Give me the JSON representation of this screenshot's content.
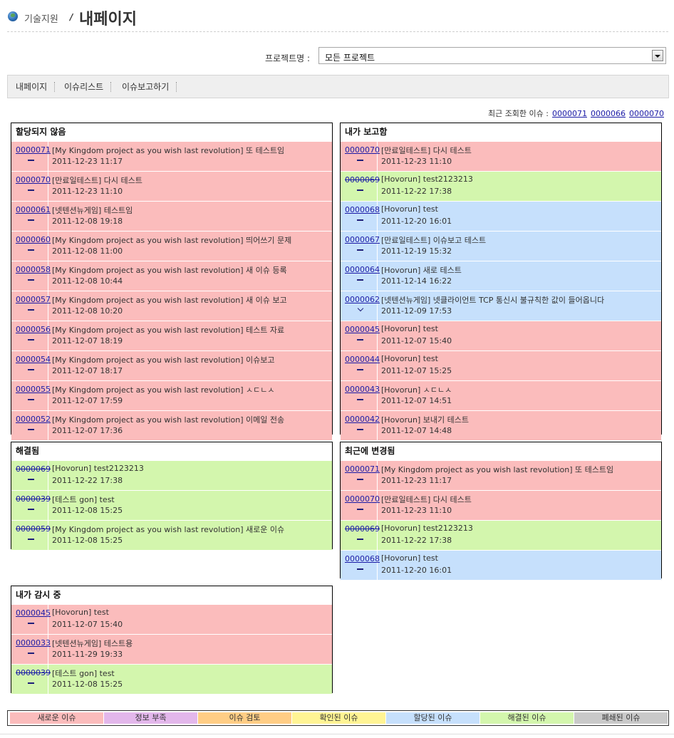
{
  "header": {
    "home": "기술지원",
    "separator": "/",
    "title": "내페이지"
  },
  "project_filter": {
    "label": "프로젝트명 :",
    "selected": "모든 프로젝트"
  },
  "tabs": [
    "내페이지",
    "이슈리스트",
    "이슈보고하기"
  ],
  "recent": {
    "label": "최근 조회한 이슈 :",
    "ids": [
      "0000071",
      "0000066",
      "0000070"
    ]
  },
  "panels": {
    "unassigned": {
      "title": "할당되지 않음",
      "rows": [
        {
          "id": "0000071",
          "title": "[My Kingdom project as you wish last revolution] 또 테스트임",
          "date": "2011-12-23 11:17",
          "status": "new"
        },
        {
          "id": "0000070",
          "title": "[만료일테스트] 다시 테스트",
          "date": "2011-12-23 11:10",
          "status": "new"
        },
        {
          "id": "0000061",
          "title": "[넷텐션뉴게임] 테스트임",
          "date": "2011-12-08 19:18",
          "status": "new"
        },
        {
          "id": "0000060",
          "title": "[My Kingdom project as you wish last revolution] 띄어쓰기 문제",
          "date": "2011-12-08 11:00",
          "status": "new"
        },
        {
          "id": "0000058",
          "title": "[My Kingdom project as you wish last revolution] 새 이슈 등록",
          "date": "2011-12-08 10:44",
          "status": "new"
        },
        {
          "id": "0000057",
          "title": "[My Kingdom project as you wish last revolution] 새 이슈 보고",
          "date": "2011-12-08 10:20",
          "status": "new"
        },
        {
          "id": "0000056",
          "title": "[My Kingdom project as you wish last revolution] 테스트 자료",
          "date": "2011-12-07 18:19",
          "status": "new"
        },
        {
          "id": "0000054",
          "title": "[My Kingdom project as you wish last revolution] 이슈보고",
          "date": "2011-12-07 18:17",
          "status": "new"
        },
        {
          "id": "0000055",
          "title": "[My Kingdom project as you wish last revolution] ㅅㄷㄴㅅ",
          "date": "2011-12-07 17:59",
          "status": "new"
        },
        {
          "id": "0000052",
          "title": "[My Kingdom project as you wish last revolution] 이메일 전송",
          "date": "2011-12-07 17:36",
          "status": "new"
        }
      ]
    },
    "reported": {
      "title": "내가 보고함",
      "rows": [
        {
          "id": "0000070",
          "title": "[만료일테스트] 다시 테스트",
          "date": "2011-12-23 11:10",
          "status": "new"
        },
        {
          "id": "0000069",
          "title": "[Hovorun] test2123213",
          "date": "2011-12-22 17:38",
          "status": "resolved",
          "strike": true
        },
        {
          "id": "0000068",
          "title": "[Hovorun] test",
          "date": "2011-12-20 16:01",
          "status": "assigned"
        },
        {
          "id": "0000067",
          "title": "[만료일테스트] 이슈보고 테스트",
          "date": "2011-12-19 15:32",
          "status": "assigned"
        },
        {
          "id": "0000064",
          "title": "[Hovorun] 새로 테스트",
          "date": "2011-12-14 16:22",
          "status": "assigned"
        },
        {
          "id": "0000062",
          "title": "[넷텐션뉴게임] 넷클라이언트 TCP 통신시 불규칙한 값이 들어옵니다",
          "date": "2011-12-09 17:53",
          "status": "assigned",
          "prio": "down"
        },
        {
          "id": "0000045",
          "title": "[Hovorun] test",
          "date": "2011-12-07 15:40",
          "status": "new"
        },
        {
          "id": "0000044",
          "title": "[Hovorun] test",
          "date": "2011-12-07 15:25",
          "status": "new"
        },
        {
          "id": "0000043",
          "title": "[Hovorun] ㅅㄷㄴㅅ",
          "date": "2011-12-07 14:51",
          "status": "new"
        },
        {
          "id": "0000042",
          "title": "[Hovorun] 보내기 테스트",
          "date": "2011-12-07 14:48",
          "status": "new"
        }
      ]
    },
    "resolved": {
      "title": "해결됨",
      "rows": [
        {
          "id": "0000069",
          "title": "[Hovorun] test2123213",
          "date": "2011-12-22 17:38",
          "status": "resolved",
          "strike": true
        },
        {
          "id": "0000039",
          "title": "[테스트 gon] test",
          "date": "2011-12-08 15:25",
          "status": "resolved",
          "strike": true
        },
        {
          "id": "0000059",
          "title": "[My Kingdom project as you wish last revolution] 새로운 이슈",
          "date": "2011-12-08 15:25",
          "status": "resolved",
          "strike": true
        }
      ]
    },
    "recently_changed": {
      "title": "최근에 변경됨",
      "rows": [
        {
          "id": "0000071",
          "title": "[My Kingdom project as you wish last revolution] 또 테스트임",
          "date": "2011-12-23 11:17",
          "status": "new"
        },
        {
          "id": "0000070",
          "title": "[만료일테스트] 다시 테스트",
          "date": "2011-12-23 11:10",
          "status": "new"
        },
        {
          "id": "0000069",
          "title": "[Hovorun] test2123213",
          "date": "2011-12-22 17:38",
          "status": "resolved",
          "strike": true
        },
        {
          "id": "0000068",
          "title": "[Hovorun] test",
          "date": "2011-12-20 16:01",
          "status": "assigned"
        }
      ]
    },
    "monitoring": {
      "title": "내가 감시 중",
      "rows": [
        {
          "id": "0000045",
          "title": "[Hovorun] test",
          "date": "2011-12-07 15:40",
          "status": "new"
        },
        {
          "id": "0000033",
          "title": "[넷텐션뉴게임] 테스트용",
          "date": "2011-11-29 19:33",
          "status": "new"
        },
        {
          "id": "0000039",
          "title": "[테스트 gon] test",
          "date": "2011-12-08 15:25",
          "status": "resolved",
          "strike": true
        }
      ]
    }
  },
  "legend": [
    {
      "label": "새로운 이슈",
      "color": "#fbbcbc"
    },
    {
      "label": "정보 부족",
      "color": "#e3b7eb"
    },
    {
      "label": "이슈 검토",
      "color": "#ffcd85"
    },
    {
      "label": "확인된 이슈",
      "color": "#fff494"
    },
    {
      "label": "할당된 이슈",
      "color": "#c6e0fc"
    },
    {
      "label": "해결된 이슈",
      "color": "#d3f6ad"
    },
    {
      "label": "폐쇄된 이슈",
      "color": "#c9c9c9"
    }
  ],
  "status_colors": {
    "new": "#fbbcbc",
    "resolved": "#d3f6ad",
    "assigned": "#c6e0fc"
  }
}
